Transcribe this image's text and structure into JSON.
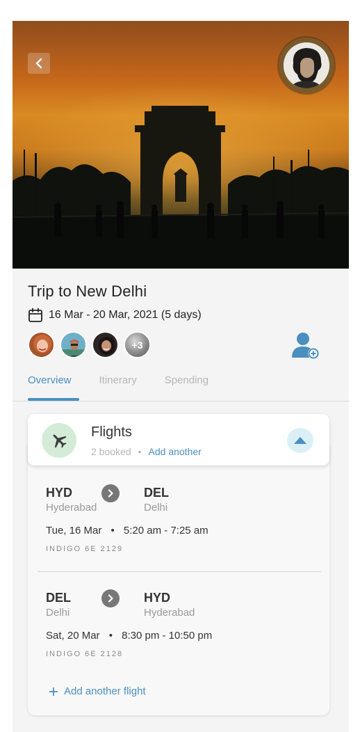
{
  "trip": {
    "title": "Trip to New Delhi",
    "dates": "16 Mar - 20 Mar, 2021 (5 days)",
    "extra_members": "+3"
  },
  "icons": {
    "back": "chevron-left-icon",
    "calendar": "calendar-icon",
    "add_member": "add-user-icon",
    "flight": "airplane-icon",
    "collapse": "triangle-up-icon",
    "arrow": "chevron-right-icon",
    "plus": "plus-icon"
  },
  "tabs": [
    {
      "label": "Overview"
    },
    {
      "label": "Itinerary"
    },
    {
      "label": "Spending"
    }
  ],
  "flights_card": {
    "title": "Flights",
    "booked": "2 booked",
    "separator": "•",
    "add_link": "Add another",
    "add_flight": "Add another flight"
  },
  "flights": [
    {
      "from_code": "HYD",
      "from_city": "Hyderabad",
      "to_code": "DEL",
      "to_city": "Delhi",
      "date": "Tue, 16 Mar",
      "sep": "•",
      "time": "5:20 am - 7:25 am",
      "airline": "INDIGO 6E 2129"
    },
    {
      "from_code": "DEL",
      "from_city": "Delhi",
      "to_code": "HYD",
      "to_city": "Hyderabad",
      "date": "Sat, 20 Mar",
      "sep": "•",
      "time": "8:30 pm - 10:50 pm",
      "airline": "INDIGO 6E 2128"
    }
  ],
  "colors": {
    "accent": "#4a8fc0",
    "plane_bg": "#d4ecd7",
    "collapse_bg": "#daf0f6"
  }
}
